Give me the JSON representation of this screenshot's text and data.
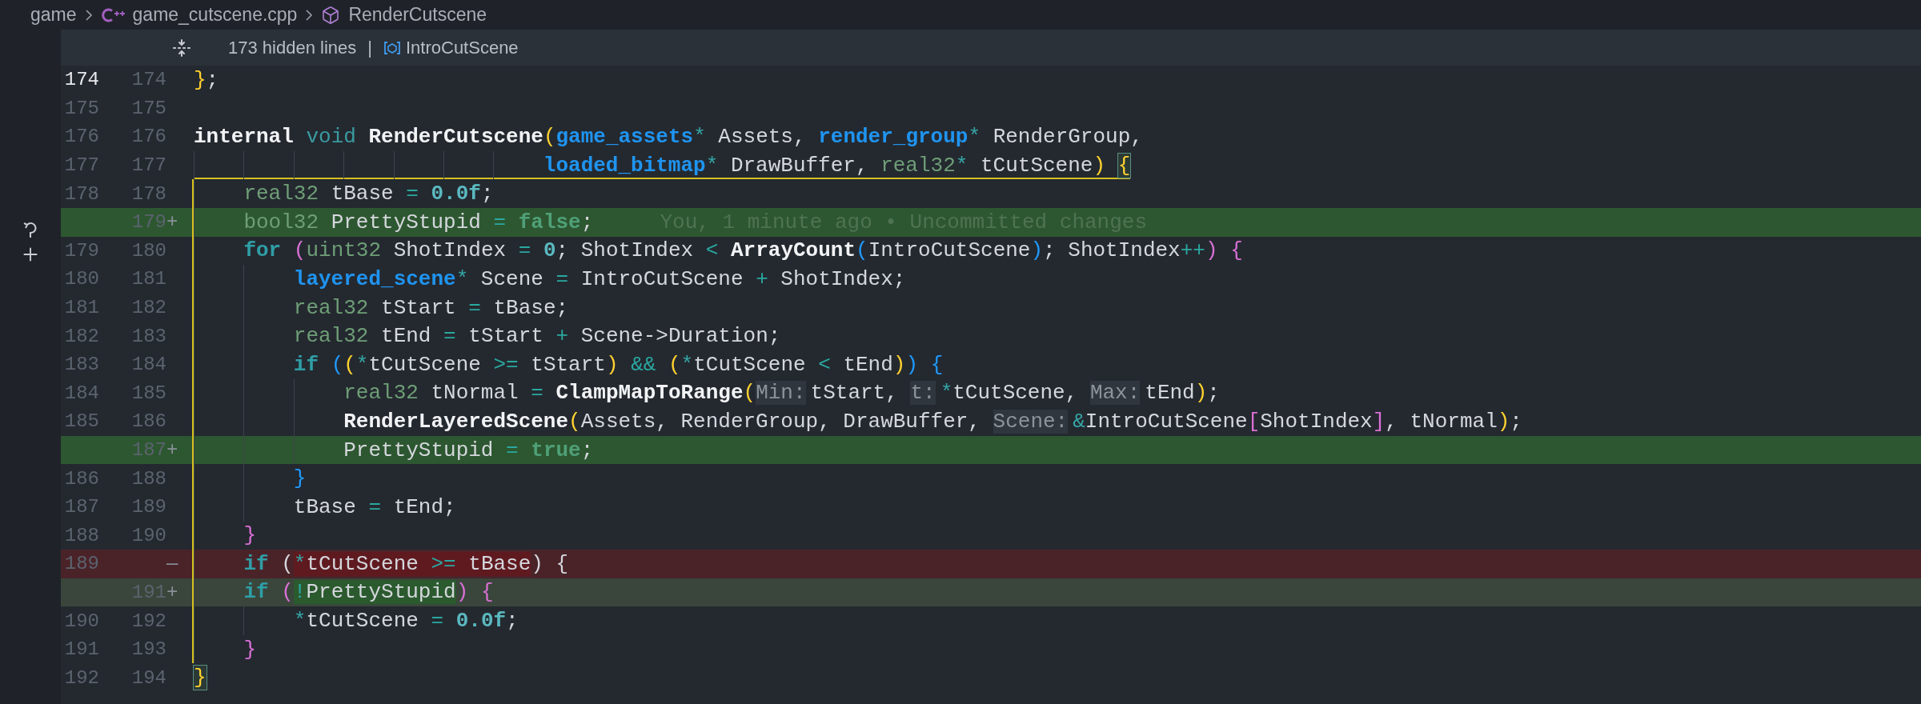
{
  "breadcrumb": [
    {
      "label": "game",
      "kind": "folder"
    },
    {
      "label": "game_cutscene.cpp",
      "kind": "cpp-file"
    },
    {
      "label": "RenderCutscene",
      "kind": "method"
    }
  ],
  "fold_header": {
    "hidden": "173 hidden lines",
    "separator": "|",
    "symbol": "IntroCutScene"
  },
  "lines": [
    {
      "old": "174",
      "new": "174",
      "kind": "context",
      "current": true,
      "tokens": [
        {
          "text": "}",
          "kind": "b1"
        },
        {
          "text": ";",
          "kind": "p"
        }
      ]
    },
    {
      "old": "175",
      "new": "175",
      "kind": "context",
      "current": false
    },
    {
      "old": "176",
      "new": "176",
      "kind": "context",
      "current": false,
      "tokens": [
        {
          "text": "internal ",
          "kind": "kw"
        },
        {
          "text": "void ",
          "kind": "kw2"
        },
        {
          "text": "RenderCutscene",
          "kind": "fn"
        },
        {
          "text": "(",
          "kind": "b1"
        },
        {
          "text": "game_assets",
          "kind": "utype"
        },
        {
          "text": "*",
          "kind": "ptr"
        },
        {
          "text": " Assets, ",
          "kind": "p"
        },
        {
          "text": "render_group",
          "kind": "utype"
        },
        {
          "text": "*",
          "kind": "ptr"
        },
        {
          "text": " RenderGroup,",
          "kind": "p"
        }
      ]
    },
    {
      "old": "177",
      "new": "177",
      "kind": "context",
      "current": false,
      "tokens": [
        {
          "text": "                             loaded_bitmap",
          "kind": "utype"
        },
        {
          "text": "*",
          "kind": "ptr"
        },
        {
          "text": " DrawBuffer, ",
          "kind": "p"
        },
        {
          "text": "real32",
          "kind": "type"
        },
        {
          "text": "*",
          "kind": "ptr"
        },
        {
          "text": " tCutScene",
          "kind": "p"
        },
        {
          "text": ") ",
          "kind": "b1"
        },
        {
          "text": "{",
          "kind": "b1",
          "boxed": true
        }
      ]
    },
    {
      "old": "178",
      "new": "178",
      "kind": "context",
      "current": false,
      "tokens": [
        {
          "text": "    real32",
          "kind": "type"
        },
        {
          "text": " tBase ",
          "kind": "p"
        },
        {
          "text": "= ",
          "kind": "op"
        },
        {
          "text": "0.0f",
          "kind": "num"
        },
        {
          "text": ";",
          "kind": "p"
        }
      ]
    },
    {
      "new": "179",
      "mark": "+",
      "kind": "added",
      "current": false,
      "tokens": [
        {
          "text": "    bool32",
          "kind": "type"
        },
        {
          "text": " PrettyStupid ",
          "kind": "p"
        },
        {
          "text": "= ",
          "kind": "op"
        },
        {
          "text": "false",
          "kind": "bool"
        },
        {
          "text": ";",
          "kind": "p"
        }
      ],
      "blame": "You, 1 minute ago • Uncommitted changes"
    },
    {
      "old": "179",
      "new": "180",
      "kind": "context",
      "current": false,
      "tokens": [
        {
          "text": "    for ",
          "kind": "ctrl"
        },
        {
          "text": "(",
          "kind": "b2"
        },
        {
          "text": "uint32",
          "kind": "type"
        },
        {
          "text": " ShotIndex ",
          "kind": "p"
        },
        {
          "text": "= ",
          "kind": "op"
        },
        {
          "text": "0",
          "kind": "num"
        },
        {
          "text": "; ShotIndex ",
          "kind": "p"
        },
        {
          "text": "< ",
          "kind": "op"
        },
        {
          "text": "ArrayCount",
          "kind": "fn"
        },
        {
          "text": "(",
          "kind": "b3"
        },
        {
          "text": "IntroCutScene",
          "kind": "p"
        },
        {
          "text": ")",
          "kind": "b3"
        },
        {
          "text": "; ShotIndex",
          "kind": "p"
        },
        {
          "text": "++",
          "kind": "op"
        },
        {
          "text": ") ",
          "kind": "b2"
        },
        {
          "text": "{",
          "kind": "b2"
        }
      ]
    },
    {
      "old": "180",
      "new": "181",
      "kind": "context",
      "current": false,
      "tokens": [
        {
          "text": "        layered_scene",
          "kind": "utype"
        },
        {
          "text": "*",
          "kind": "ptr"
        },
        {
          "text": " Scene ",
          "kind": "p"
        },
        {
          "text": "=",
          "kind": "op"
        },
        {
          "text": " IntroCutScene ",
          "kind": "p"
        },
        {
          "text": "+",
          "kind": "op"
        },
        {
          "text": " ShotIndex;",
          "kind": "p"
        }
      ]
    },
    {
      "old": "181",
      "new": "182",
      "kind": "context",
      "current": false,
      "tokens": [
        {
          "text": "        real32",
          "kind": "type"
        },
        {
          "text": " tStart ",
          "kind": "p"
        },
        {
          "text": "=",
          "kind": "op"
        },
        {
          "text": " tBase;",
          "kind": "p"
        }
      ]
    },
    {
      "old": "182",
      "new": "183",
      "kind": "context",
      "current": false,
      "tokens": [
        {
          "text": "        real32",
          "kind": "type"
        },
        {
          "text": " tEnd ",
          "kind": "p"
        },
        {
          "text": "=",
          "kind": "op"
        },
        {
          "text": " tStart ",
          "kind": "p"
        },
        {
          "text": "+",
          "kind": "op"
        },
        {
          "text": " Scene->Duration;",
          "kind": "p"
        }
      ]
    },
    {
      "old": "183",
      "new": "184",
      "kind": "context",
      "current": false,
      "tokens": [
        {
          "text": "        if ",
          "kind": "ctrl"
        },
        {
          "text": "(",
          "kind": "b3"
        },
        {
          "text": "(",
          "kind": "b1"
        },
        {
          "text": "*",
          "kind": "ptr"
        },
        {
          "text": "tCutScene ",
          "kind": "p"
        },
        {
          "text": ">=",
          "kind": "op"
        },
        {
          "text": " tStart",
          "kind": "p"
        },
        {
          "text": ") ",
          "kind": "b1"
        },
        {
          "text": "&& ",
          "kind": "op"
        },
        {
          "text": "(",
          "kind": "b1"
        },
        {
          "text": "*",
          "kind": "ptr"
        },
        {
          "text": "tCutScene ",
          "kind": "p"
        },
        {
          "text": "<",
          "kind": "op"
        },
        {
          "text": " tEnd",
          "kind": "p"
        },
        {
          "text": ")",
          "kind": "b1"
        },
        {
          "text": ") ",
          "kind": "b3"
        },
        {
          "text": "{",
          "kind": "b3"
        }
      ]
    },
    {
      "old": "184",
      "new": "185",
      "kind": "context",
      "current": false,
      "tokens": [
        {
          "text": "            real32",
          "kind": "type"
        },
        {
          "text": " tNormal ",
          "kind": "p"
        },
        {
          "text": "= ",
          "kind": "op"
        },
        {
          "text": "ClampMapToRange",
          "kind": "fn"
        },
        {
          "text": "(",
          "kind": "b1"
        },
        {
          "text": "Min:",
          "kind": "hint"
        },
        {
          "text": "tStart, ",
          "kind": "p"
        },
        {
          "text": "t:",
          "kind": "hint"
        },
        {
          "text": "*",
          "kind": "ptr"
        },
        {
          "text": "tCutScene, ",
          "kind": "p"
        },
        {
          "text": "Max:",
          "kind": "hint"
        },
        {
          "text": "tEnd",
          "kind": "p"
        },
        {
          "text": ")",
          "kind": "b1"
        },
        {
          "text": ";",
          "kind": "p"
        }
      ]
    },
    {
      "old": "185",
      "new": "186",
      "kind": "context",
      "current": false,
      "tokens": [
        {
          "text": "            RenderLayeredScene",
          "kind": "fn"
        },
        {
          "text": "(",
          "kind": "b1"
        },
        {
          "text": "Assets, RenderGroup, DrawBuffer, ",
          "kind": "p"
        },
        {
          "text": "Scene:",
          "kind": "hint"
        },
        {
          "text": "&",
          "kind": "ptr"
        },
        {
          "text": "IntroCutScene",
          "kind": "p"
        },
        {
          "text": "[",
          "kind": "b2"
        },
        {
          "text": "ShotIndex",
          "kind": "p"
        },
        {
          "text": "]",
          "kind": "b2"
        },
        {
          "text": ", tNormal",
          "kind": "p"
        },
        {
          "text": ")",
          "kind": "b1"
        },
        {
          "text": ";",
          "kind": "p"
        }
      ]
    },
    {
      "new": "187",
      "mark": "+",
      "kind": "added",
      "current": false,
      "tokens": [
        {
          "text": "            PrettyStupid ",
          "kind": "p"
        },
        {
          "text": "= ",
          "kind": "op"
        },
        {
          "text": "true",
          "kind": "bool"
        },
        {
          "text": ";",
          "kind": "p"
        }
      ]
    },
    {
      "old": "186",
      "new": "188",
      "kind": "context",
      "current": false,
      "tokens": [
        {
          "text": "        }",
          "kind": "b3"
        }
      ]
    },
    {
      "old": "187",
      "new": "189",
      "kind": "context",
      "current": false,
      "tokens": [
        {
          "text": "        tBase ",
          "kind": "p"
        },
        {
          "text": "=",
          "kind": "op"
        },
        {
          "text": " tEnd;",
          "kind": "p"
        }
      ]
    },
    {
      "old": "188",
      "new": "190",
      "kind": "context",
      "current": false,
      "tokens": [
        {
          "text": "    }",
          "kind": "b2"
        }
      ]
    },
    {
      "old": "189",
      "mark": "—",
      "kind": "removed",
      "current": false,
      "tokens": [
        {
          "text": "    if",
          "kind": "ctrl"
        },
        {
          "text": " (",
          "kind": "p"
        },
        {
          "text": "*",
          "kind": "ptr",
          "hl": true
        },
        {
          "text": "tCutScene ",
          "kind": "p",
          "hl": true
        },
        {
          "text": ">=",
          "kind": "op",
          "hl": true
        },
        {
          "text": " tBase",
          "kind": "p",
          "hl": true
        },
        {
          "text": ") {",
          "kind": "p"
        }
      ]
    },
    {
      "new": "191",
      "mark": "+",
      "kind": "modified",
      "current": false,
      "tokens": [
        {
          "text": "    if ",
          "kind": "ctrl"
        },
        {
          "text": "(",
          "kind": "b2"
        },
        {
          "text": "!",
          "kind": "op",
          "hl": true
        },
        {
          "text": "PrettyStupid",
          "kind": "p",
          "hl": true
        },
        {
          "text": ") ",
          "kind": "b2"
        },
        {
          "text": "{",
          "kind": "b2"
        }
      ]
    },
    {
      "old": "190",
      "new": "192",
      "kind": "context",
      "current": false,
      "tokens": [
        {
          "text": "        *",
          "kind": "ptr"
        },
        {
          "text": "tCutScene ",
          "kind": "p"
        },
        {
          "text": "= ",
          "kind": "op"
        },
        {
          "text": "0.0f",
          "kind": "num"
        },
        {
          "text": ";",
          "kind": "p"
        }
      ]
    },
    {
      "old": "191",
      "new": "193",
      "kind": "context",
      "current": false,
      "tokens": [
        {
          "text": "    }",
          "kind": "b2"
        }
      ]
    },
    {
      "old": "192",
      "new": "194",
      "kind": "context",
      "current": false,
      "tokens": [
        {
          "text": "}",
          "kind": "b1",
          "boxed": true
        }
      ]
    }
  ]
}
